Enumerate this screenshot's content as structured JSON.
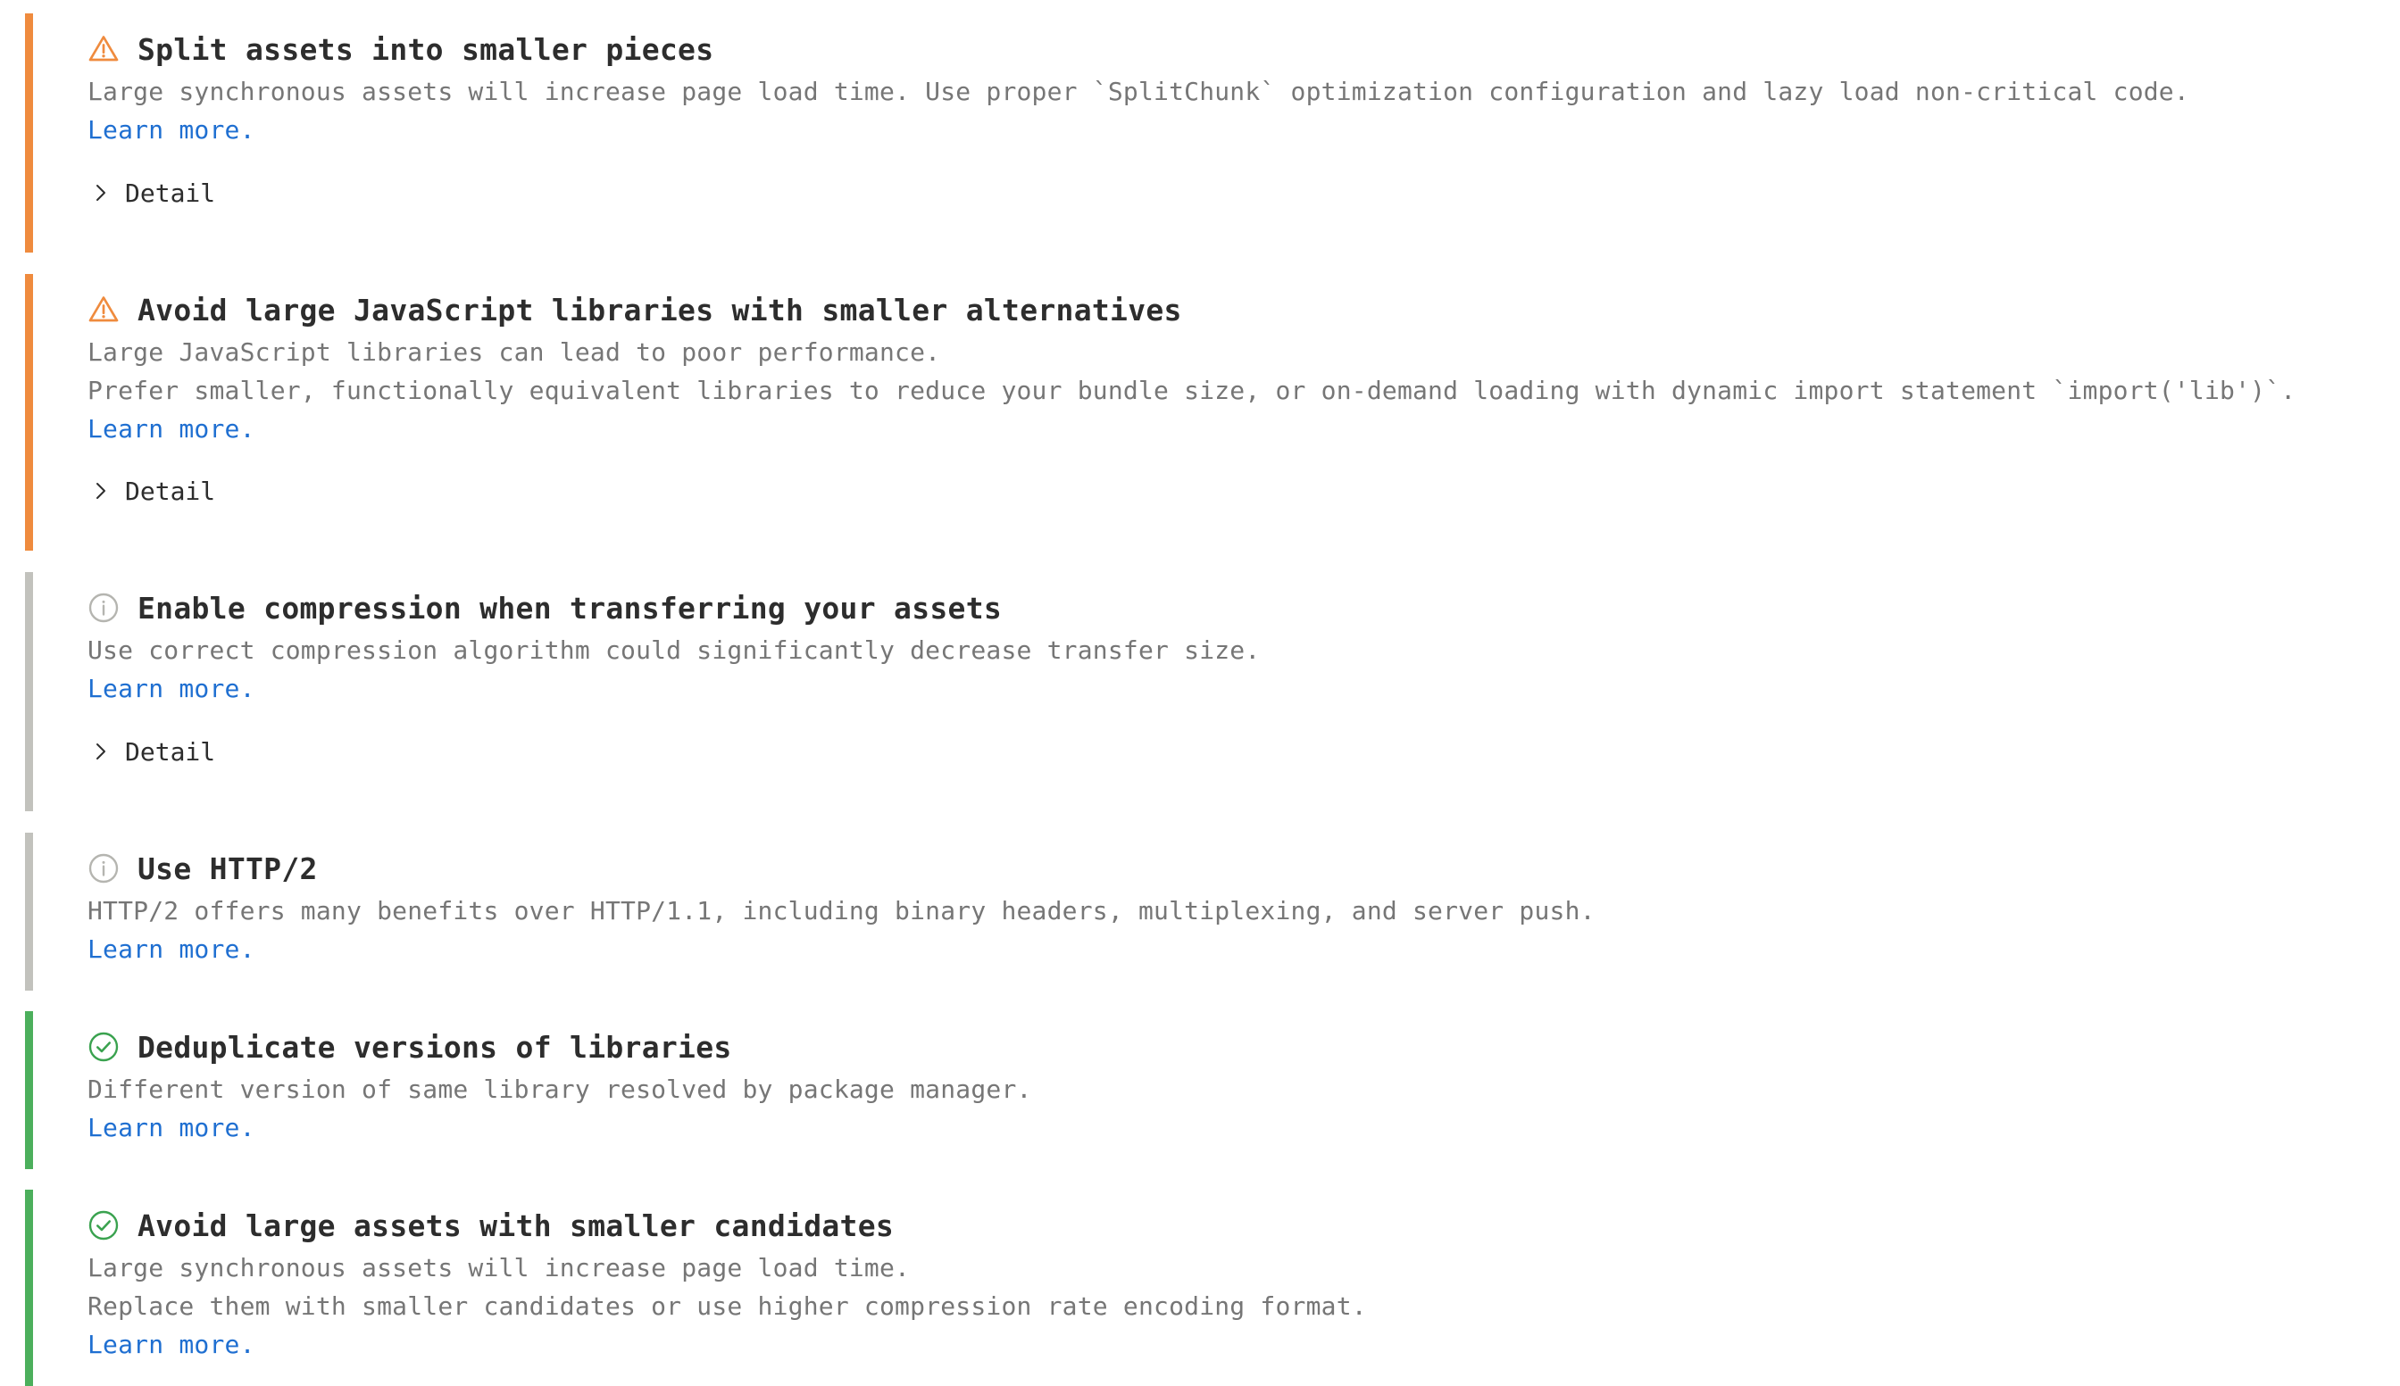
{
  "colors": {
    "warning": "#ef8b3e",
    "info": "#c2c2bd",
    "success": "#4caf5c",
    "link": "#1f6fd1",
    "title": "#2d2d2d",
    "description": "#767676"
  },
  "items": [
    {
      "status": "warning",
      "icon": "warning-icon",
      "title": "Split assets into smaller pieces",
      "lines": [
        "Large synchronous assets will increase page load time. Use proper `SplitChunk` optimization configuration and lazy load non-critical code."
      ],
      "learn_more": "Learn more.",
      "detail_label": "Detail"
    },
    {
      "status": "warning",
      "icon": "warning-icon",
      "title": "Avoid large JavaScript libraries with smaller alternatives",
      "lines": [
        "Large JavaScript libraries can lead to poor performance.",
        "Prefer smaller, functionally equivalent libraries to reduce your bundle size, or on-demand loading with dynamic import statement `import('lib')`."
      ],
      "learn_more": "Learn more.",
      "detail_label": "Detail"
    },
    {
      "status": "info",
      "icon": "info-icon",
      "title": "Enable compression when transferring your assets",
      "lines": [
        "Use correct compression algorithm could significantly decrease transfer size."
      ],
      "learn_more": "Learn more.",
      "detail_label": "Detail"
    },
    {
      "status": "info",
      "icon": "info-icon",
      "title": "Use HTTP/2",
      "lines": [
        "HTTP/2 offers many benefits over HTTP/1.1, including binary headers, multiplexing, and server push."
      ],
      "learn_more": "Learn more."
    },
    {
      "status": "success",
      "icon": "check-circle-icon",
      "title": "Deduplicate versions of libraries",
      "lines": [
        "Different version of same library resolved by package manager."
      ],
      "learn_more": "Learn more."
    },
    {
      "status": "success",
      "icon": "check-circle-icon",
      "title": "Avoid large assets with smaller candidates",
      "lines": [
        "Large synchronous assets will increase page load time.",
        "Replace them with smaller candidates or use higher compression rate encoding format."
      ],
      "learn_more": "Learn more."
    }
  ]
}
